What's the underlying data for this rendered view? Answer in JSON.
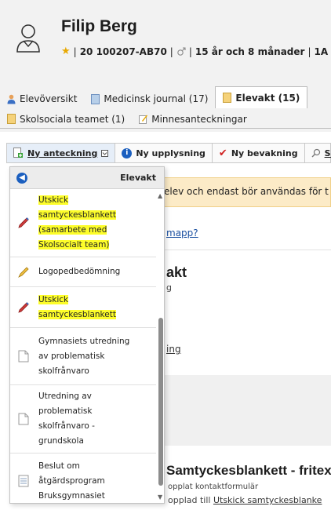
{
  "student": {
    "name": "Filip Berg",
    "id_number": "20 100207-AB70",
    "age": "15 år och 8 månader",
    "class": "1A"
  },
  "tabs_row1": [
    {
      "label": "Elevöversikt",
      "icon": "person-icon"
    },
    {
      "label": "Medicinsk journal (17)",
      "icon": "document-blue-icon"
    },
    {
      "label": "Elevakt (15)",
      "icon": "folder-yellow-icon",
      "active": true
    }
  ],
  "tabs_row2": [
    {
      "label": "Skolsociala teamet (1)",
      "icon": "folder-yellow-icon"
    },
    {
      "label": "Minnesanteckningar",
      "icon": "note-pencil-icon"
    }
  ],
  "toolbar": {
    "new_note": "Ny anteckning",
    "new_info": "Ny upplysning",
    "new_watch": "Ny bevakning",
    "search": "Sök"
  },
  "background": {
    "notice_text": "elev och endast bör användas för t",
    "mapp_link": "mapp?",
    "title_fragment": "akt",
    "small_fragment": "g",
    "link_fragment": "ing",
    "title2": "Samtyckesblankett - fritex",
    "sub1": "opplat kontaktformulär",
    "sub2_prefix": "opplad till ",
    "sub2_link": "Utskick samtyckesblanke"
  },
  "dropdown": {
    "title": "Elevakt",
    "items": [
      {
        "lines": [
          "Utskick",
          "samtyckesblankett",
          "(samarbete med",
          "Skolsocialt team)"
        ],
        "icon": "pen-red-icon",
        "highlight": true
      },
      {
        "lines": [
          "Logopedbedömning"
        ],
        "icon": "pencil-yellow-icon",
        "highlight": false
      },
      {
        "lines": [
          "Utskick",
          "samtyckesblankett"
        ],
        "icon": "pen-red-icon",
        "highlight": true
      },
      {
        "lines": [
          "Gymnasiets utredning",
          "av problematisk",
          "skolfrånvaro"
        ],
        "icon": "blank-document-icon",
        "highlight": false
      },
      {
        "lines": [
          "Utredning av",
          "problematisk",
          "skolfrånvaro -",
          "grundskola"
        ],
        "icon": "blank-document-icon",
        "highlight": false
      },
      {
        "lines": [
          "Beslut om",
          "åtgärdsprogram",
          "Bruksgymnasiet"
        ],
        "icon": "form-document-icon",
        "highlight": false
      }
    ]
  },
  "colors": {
    "accent_blue": "#1b5fbf",
    "highlight_yellow": "#fdfd2a",
    "notice_bg": "#fcebc7"
  }
}
